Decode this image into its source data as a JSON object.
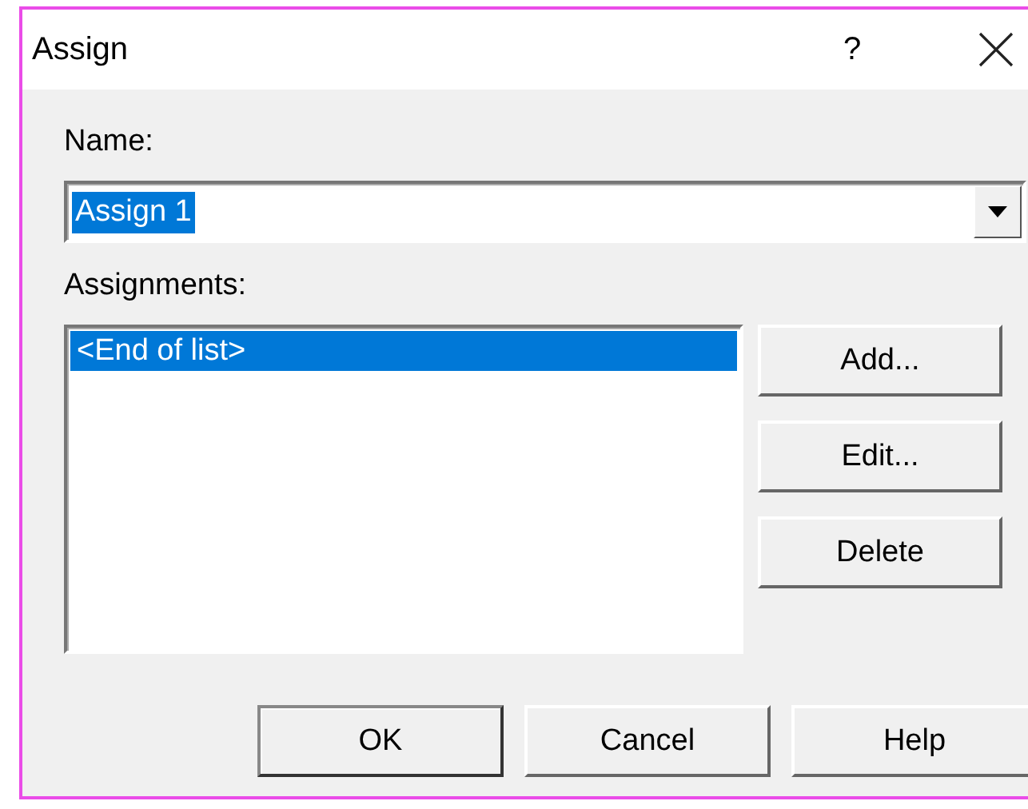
{
  "window": {
    "title": "Assign",
    "help_glyph": "?"
  },
  "name_field": {
    "label": "Name:",
    "value": "Assign 1",
    "text_selected": true
  },
  "assignments": {
    "label": "Assignments:",
    "items": [
      {
        "text": "<End of list>",
        "selected": true
      }
    ]
  },
  "side_buttons": [
    {
      "label": "Add..."
    },
    {
      "label": "Edit..."
    },
    {
      "label": "Delete"
    }
  ],
  "buttons": [
    {
      "label": "OK",
      "default": true
    },
    {
      "label": "Cancel",
      "default": false
    },
    {
      "label": "Help",
      "default": false
    }
  ]
}
